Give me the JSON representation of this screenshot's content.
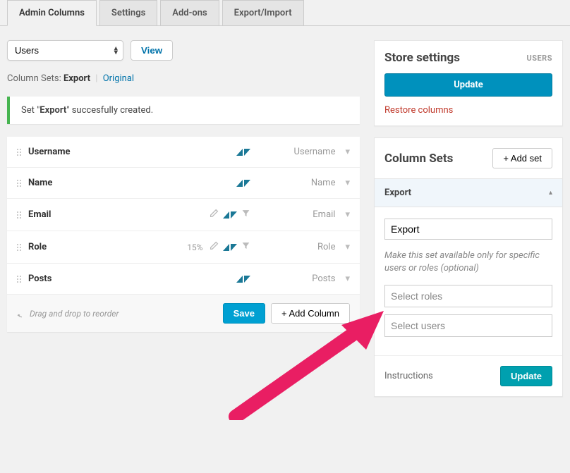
{
  "tabs": {
    "t0": "Admin Columns",
    "t1": "Settings",
    "t2": "Add-ons",
    "t3": "Export/Import"
  },
  "topbar": {
    "select": "Users",
    "view": "View"
  },
  "breadcrumb": {
    "label": "Column Sets:",
    "current": "Export",
    "original": "Original"
  },
  "alert": {
    "pre": "Set \"",
    "name": "Export",
    "post": "\" succesfully created."
  },
  "columns": [
    {
      "name": "Username",
      "type": "Username",
      "edit": false,
      "filter": false,
      "pct": ""
    },
    {
      "name": "Name",
      "type": "Name",
      "edit": false,
      "filter": false,
      "pct": ""
    },
    {
      "name": "Email",
      "type": "Email",
      "edit": true,
      "filter": true,
      "pct": ""
    },
    {
      "name": "Role",
      "type": "Role",
      "edit": true,
      "filter": true,
      "pct": "15%"
    },
    {
      "name": "Posts",
      "type": "Posts",
      "edit": false,
      "filter": false,
      "pct": ""
    }
  ],
  "footer": {
    "tip": "Drag and drop to reorder",
    "save": "Save",
    "add_col": "+ Add Column"
  },
  "store": {
    "title": "Store settings",
    "tag": "USERS",
    "update": "Update",
    "restore": "Restore columns"
  },
  "sets": {
    "title": "Column Sets",
    "add": "+ Add set",
    "acc_title": "Export",
    "name_value": "Export",
    "hint": "Make this set available only for specific users or roles (optional)",
    "roles_ph": "Select roles",
    "users_ph": "Select users",
    "instructions": "Instructions",
    "update": "Update"
  }
}
